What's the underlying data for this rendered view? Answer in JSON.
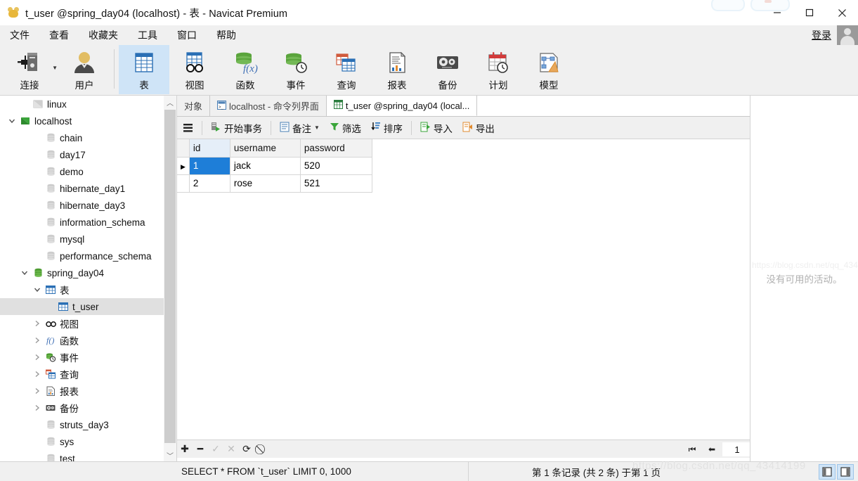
{
  "window": {
    "title": "t_user @spring_day04 (localhost) - 表 - Navicat Premium",
    "minimize": "—",
    "maximize": "□",
    "close": "✕"
  },
  "menu": {
    "items": [
      {
        "label": "文件"
      },
      {
        "label": "查看"
      },
      {
        "label": "收藏夹"
      },
      {
        "label": "工具"
      },
      {
        "label": "窗口"
      },
      {
        "label": "帮助"
      }
    ],
    "login_label": "登录"
  },
  "toolbar": {
    "items": [
      {
        "label": "连接",
        "icon": "connection-icon",
        "active": false,
        "dropdown": true
      },
      {
        "label": "用户",
        "icon": "user-icon",
        "active": false
      },
      {
        "label": "表",
        "icon": "table-icon",
        "active": true
      },
      {
        "label": "视图",
        "icon": "view-icon",
        "active": false
      },
      {
        "label": "函数",
        "icon": "function-icon",
        "active": false
      },
      {
        "label": "事件",
        "icon": "event-icon",
        "active": false
      },
      {
        "label": "查询",
        "icon": "query-icon",
        "active": false
      },
      {
        "label": "报表",
        "icon": "report-icon",
        "active": false
      },
      {
        "label": "备份",
        "icon": "backup-icon",
        "active": false
      },
      {
        "label": "计划",
        "icon": "schedule-icon",
        "active": false
      },
      {
        "label": "模型",
        "icon": "model-icon",
        "active": false
      }
    ]
  },
  "sidebar": {
    "items": [
      {
        "label": "linux",
        "depth": 1,
        "icon": "connection-gray-icon",
        "twisty": "",
        "selected": false
      },
      {
        "label": "localhost",
        "depth": 0,
        "icon": "connection-green-icon",
        "twisty": "v",
        "selected": false
      },
      {
        "label": "chain",
        "depth": 2,
        "icon": "database-gray-icon",
        "twisty": "",
        "selected": false
      },
      {
        "label": "day17",
        "depth": 2,
        "icon": "database-gray-icon",
        "twisty": "",
        "selected": false
      },
      {
        "label": "demo",
        "depth": 2,
        "icon": "database-gray-icon",
        "twisty": "",
        "selected": false
      },
      {
        "label": "hibernate_day1",
        "depth": 2,
        "icon": "database-gray-icon",
        "twisty": "",
        "selected": false
      },
      {
        "label": "hibernate_day3",
        "depth": 2,
        "icon": "database-gray-icon",
        "twisty": "",
        "selected": false
      },
      {
        "label": "information_schema",
        "depth": 2,
        "icon": "database-gray-icon",
        "twisty": "",
        "selected": false
      },
      {
        "label": "mysql",
        "depth": 2,
        "icon": "database-gray-icon",
        "twisty": "",
        "selected": false
      },
      {
        "label": "performance_schema",
        "depth": 2,
        "icon": "database-gray-icon",
        "twisty": "",
        "selected": false
      },
      {
        "label": "spring_day04",
        "depth": 1,
        "icon": "database-green-icon",
        "twisty": "v",
        "selected": false
      },
      {
        "label": "表",
        "depth": 2,
        "icon": "table-icon",
        "twisty": "v",
        "selected": false
      },
      {
        "label": "t_user",
        "depth": 3,
        "icon": "table-icon",
        "twisty": "",
        "selected": true
      },
      {
        "label": "视图",
        "depth": 2,
        "icon": "view-icon",
        "twisty": ">",
        "selected": false
      },
      {
        "label": "函数",
        "depth": 2,
        "icon": "function-icon",
        "twisty": ">",
        "selected": false
      },
      {
        "label": "事件",
        "depth": 2,
        "icon": "event-icon",
        "twisty": ">",
        "selected": false
      },
      {
        "label": "查询",
        "depth": 2,
        "icon": "query-icon",
        "twisty": ">",
        "selected": false
      },
      {
        "label": "报表",
        "depth": 2,
        "icon": "report-icon",
        "twisty": ">",
        "selected": false
      },
      {
        "label": "备份",
        "depth": 2,
        "icon": "backup-icon",
        "twisty": ">",
        "selected": false
      },
      {
        "label": "struts_day3",
        "depth": 2,
        "icon": "database-gray-icon",
        "twisty": "",
        "selected": false
      },
      {
        "label": "sys",
        "depth": 2,
        "icon": "database-gray-icon",
        "twisty": "",
        "selected": false
      },
      {
        "label": "test",
        "depth": 2,
        "icon": "database-gray-icon",
        "twisty": "",
        "selected": false
      }
    ]
  },
  "tabs": [
    {
      "label": "对象",
      "icon": "",
      "active": false
    },
    {
      "label": "localhost - 命令列界面",
      "icon": "console-icon",
      "active": false
    },
    {
      "label": "t_user @spring_day04 (local...",
      "icon": "table-icon",
      "active": true
    }
  ],
  "actionbar": {
    "menu_icon": "hamburger-icon",
    "items": [
      {
        "label": "开始事务",
        "icon": "begin-transaction-icon",
        "dropdown": false
      },
      {
        "label": "备注",
        "icon": "note-icon",
        "dropdown": true
      },
      {
        "label": "筛选",
        "icon": "filter-icon",
        "dropdown": false
      },
      {
        "label": "排序",
        "icon": "sort-icon",
        "dropdown": false
      },
      {
        "label": "导入",
        "icon": "import-icon",
        "dropdown": false
      },
      {
        "label": "导出",
        "icon": "export-icon",
        "dropdown": false
      }
    ]
  },
  "grid": {
    "columns": [
      "id",
      "username",
      "password"
    ],
    "rows": [
      {
        "current": true,
        "cells": [
          "1",
          "jack",
          "520"
        ]
      },
      {
        "current": false,
        "cells": [
          "2",
          "rose",
          "521"
        ]
      }
    ],
    "selected_cell": {
      "row": 0,
      "col": 0
    },
    "selection_color": "#1e7ed8"
  },
  "recordbar": {
    "buttons": [
      {
        "icon": "plus-icon",
        "glyph": "✚",
        "enabled": true
      },
      {
        "icon": "minus-icon",
        "glyph": "━",
        "enabled": true
      },
      {
        "icon": "check-icon",
        "glyph": "✓",
        "enabled": false
      },
      {
        "icon": "cancel-icon",
        "glyph": "✕",
        "enabled": false
      },
      {
        "icon": "refresh-icon",
        "glyph": "⟳",
        "enabled": true
      },
      {
        "icon": "stop-icon",
        "glyph": "⃠",
        "enabled": true
      }
    ],
    "pager": {
      "first": "⏮",
      "prev": "⬅",
      "page_value": "1",
      "next": "➡",
      "last": "⏭",
      "settings": "⚙",
      "view_grid": "grid-view-icon",
      "view_form": "form-view-icon",
      "active_view": "grid"
    }
  },
  "info_panel": {
    "empty_text": "没有可用的活动。"
  },
  "statusbar": {
    "sql": "SELECT * FROM `t_user` LIMIT 0, 1000",
    "record_info": "第 1 条记录 (共 2 条) 于第 1 页",
    "toggles": [
      {
        "icon": "toggle-left-panel-icon",
        "active": true
      },
      {
        "icon": "toggle-right-panel-icon",
        "active": true
      }
    ]
  },
  "watermark": {
    "text": "https://blog.csdn.net/qq_43414199"
  },
  "colors": {
    "accent": "#1e7ed8",
    "toolbar_bg": "#f0f0f0",
    "active_tab_bg": "#cfe4f7",
    "selection_gray": "#e0e0e0",
    "green": "#4a9c2d",
    "orange": "#e08a2e"
  }
}
